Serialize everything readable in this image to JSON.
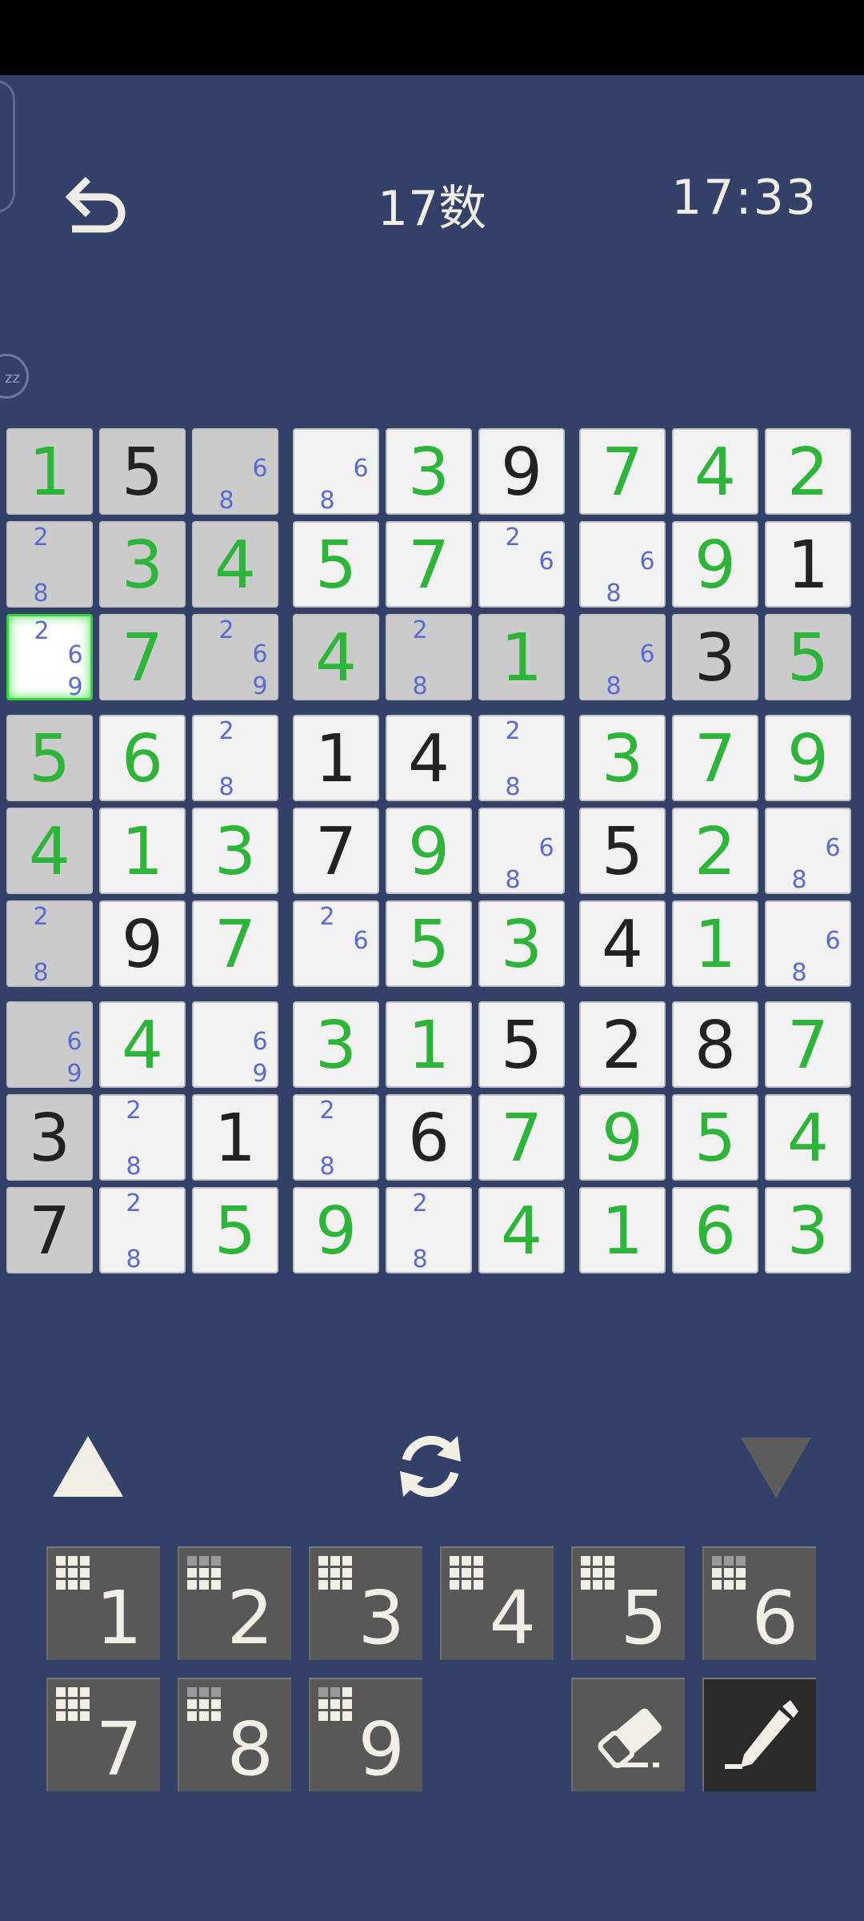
{
  "header": {
    "title": "17数",
    "clock": "17:33",
    "edge_badge": "zz"
  },
  "board": {
    "selected_cell": [
      2,
      0
    ],
    "cells": [
      [
        {
          "v": "1",
          "t": "user"
        },
        {
          "v": "5",
          "t": "given"
        },
        {
          "c": [
            "6",
            "8"
          ]
        },
        {
          "c": [
            "6",
            "8"
          ]
        },
        {
          "v": "3",
          "t": "user"
        },
        {
          "v": "9",
          "t": "given"
        },
        {
          "v": "7",
          "t": "user"
        },
        {
          "v": "4",
          "t": "user"
        },
        {
          "v": "2",
          "t": "user"
        }
      ],
      [
        {
          "c": [
            "2",
            "8"
          ]
        },
        {
          "v": "3",
          "t": "user"
        },
        {
          "v": "4",
          "t": "user"
        },
        {
          "v": "5",
          "t": "user"
        },
        {
          "v": "7",
          "t": "user"
        },
        {
          "c": [
            "2",
            "6"
          ]
        },
        {
          "c": [
            "6",
            "8"
          ]
        },
        {
          "v": "9",
          "t": "user"
        },
        {
          "v": "1",
          "t": "given"
        }
      ],
      [
        {
          "c": [
            "2",
            "6",
            "9"
          ]
        },
        {
          "v": "7",
          "t": "user"
        },
        {
          "c": [
            "2",
            "6",
            "9"
          ]
        },
        {
          "v": "4",
          "t": "user"
        },
        {
          "c": [
            "2",
            "8"
          ]
        },
        {
          "v": "1",
          "t": "user"
        },
        {
          "c": [
            "6",
            "8"
          ]
        },
        {
          "v": "3",
          "t": "given"
        },
        {
          "v": "5",
          "t": "user"
        }
      ],
      [
        {
          "v": "5",
          "t": "user"
        },
        {
          "v": "6",
          "t": "user"
        },
        {
          "c": [
            "2",
            "8"
          ]
        },
        {
          "v": "1",
          "t": "given"
        },
        {
          "v": "4",
          "t": "given"
        },
        {
          "c": [
            "2",
            "8"
          ]
        },
        {
          "v": "3",
          "t": "user"
        },
        {
          "v": "7",
          "t": "user"
        },
        {
          "v": "9",
          "t": "user"
        }
      ],
      [
        {
          "v": "4",
          "t": "user"
        },
        {
          "v": "1",
          "t": "user"
        },
        {
          "v": "3",
          "t": "user"
        },
        {
          "v": "7",
          "t": "given"
        },
        {
          "v": "9",
          "t": "user"
        },
        {
          "c": [
            "6",
            "8"
          ]
        },
        {
          "v": "5",
          "t": "given"
        },
        {
          "v": "2",
          "t": "user"
        },
        {
          "c": [
            "6",
            "8"
          ]
        }
      ],
      [
        {
          "c": [
            "2",
            "8"
          ]
        },
        {
          "v": "9",
          "t": "given"
        },
        {
          "v": "7",
          "t": "user"
        },
        {
          "c": [
            "2",
            "6"
          ]
        },
        {
          "v": "5",
          "t": "user"
        },
        {
          "v": "3",
          "t": "user"
        },
        {
          "v": "4",
          "t": "given"
        },
        {
          "v": "1",
          "t": "user"
        },
        {
          "c": [
            "6",
            "8"
          ]
        }
      ],
      [
        {
          "c": [
            "6",
            "9"
          ]
        },
        {
          "v": "4",
          "t": "user"
        },
        {
          "c": [
            "6",
            "9"
          ]
        },
        {
          "v": "3",
          "t": "user"
        },
        {
          "v": "1",
          "t": "user"
        },
        {
          "v": "5",
          "t": "given"
        },
        {
          "v": "2",
          "t": "given"
        },
        {
          "v": "8",
          "t": "given"
        },
        {
          "v": "7",
          "t": "user"
        }
      ],
      [
        {
          "v": "3",
          "t": "given"
        },
        {
          "c": [
            "2",
            "8"
          ]
        },
        {
          "v": "1",
          "t": "given"
        },
        {
          "c": [
            "2",
            "8"
          ]
        },
        {
          "v": "6",
          "t": "given"
        },
        {
          "v": "7",
          "t": "user"
        },
        {
          "v": "9",
          "t": "user"
        },
        {
          "v": "5",
          "t": "user"
        },
        {
          "v": "4",
          "t": "user"
        }
      ],
      [
        {
          "v": "7",
          "t": "given"
        },
        {
          "c": [
            "2",
            "8"
          ]
        },
        {
          "v": "5",
          "t": "user"
        },
        {
          "v": "9",
          "t": "user"
        },
        {
          "c": [
            "2",
            "8"
          ]
        },
        {
          "v": "4",
          "t": "user"
        },
        {
          "v": "1",
          "t": "user"
        },
        {
          "v": "6",
          "t": "user"
        },
        {
          "v": "3",
          "t": "user"
        }
      ]
    ]
  },
  "controls": {
    "up_icon": "triangle-up-icon",
    "refresh_icon": "refresh-icon",
    "down_icon": "triangle-down-icon"
  },
  "keypad": {
    "keys": [
      {
        "label": "1",
        "remaining": 0
      },
      {
        "label": "2",
        "remaining": 3
      },
      {
        "label": "3",
        "remaining": 0
      },
      {
        "label": "4",
        "remaining": 0
      },
      {
        "label": "5",
        "remaining": 0
      },
      {
        "label": "6",
        "remaining": 3
      },
      {
        "label": "7",
        "remaining": 0
      },
      {
        "label": "8",
        "remaining": 3
      },
      {
        "label": "9",
        "remaining": 2
      }
    ],
    "eraser_icon": "eraser-icon",
    "pencil_icon": "pencil-icon"
  },
  "colors": {
    "background": "#334068",
    "given_digit": "#222222",
    "user_digit": "#2db53a",
    "candidate": "#5a6ad0",
    "selection": "#35d33a"
  }
}
